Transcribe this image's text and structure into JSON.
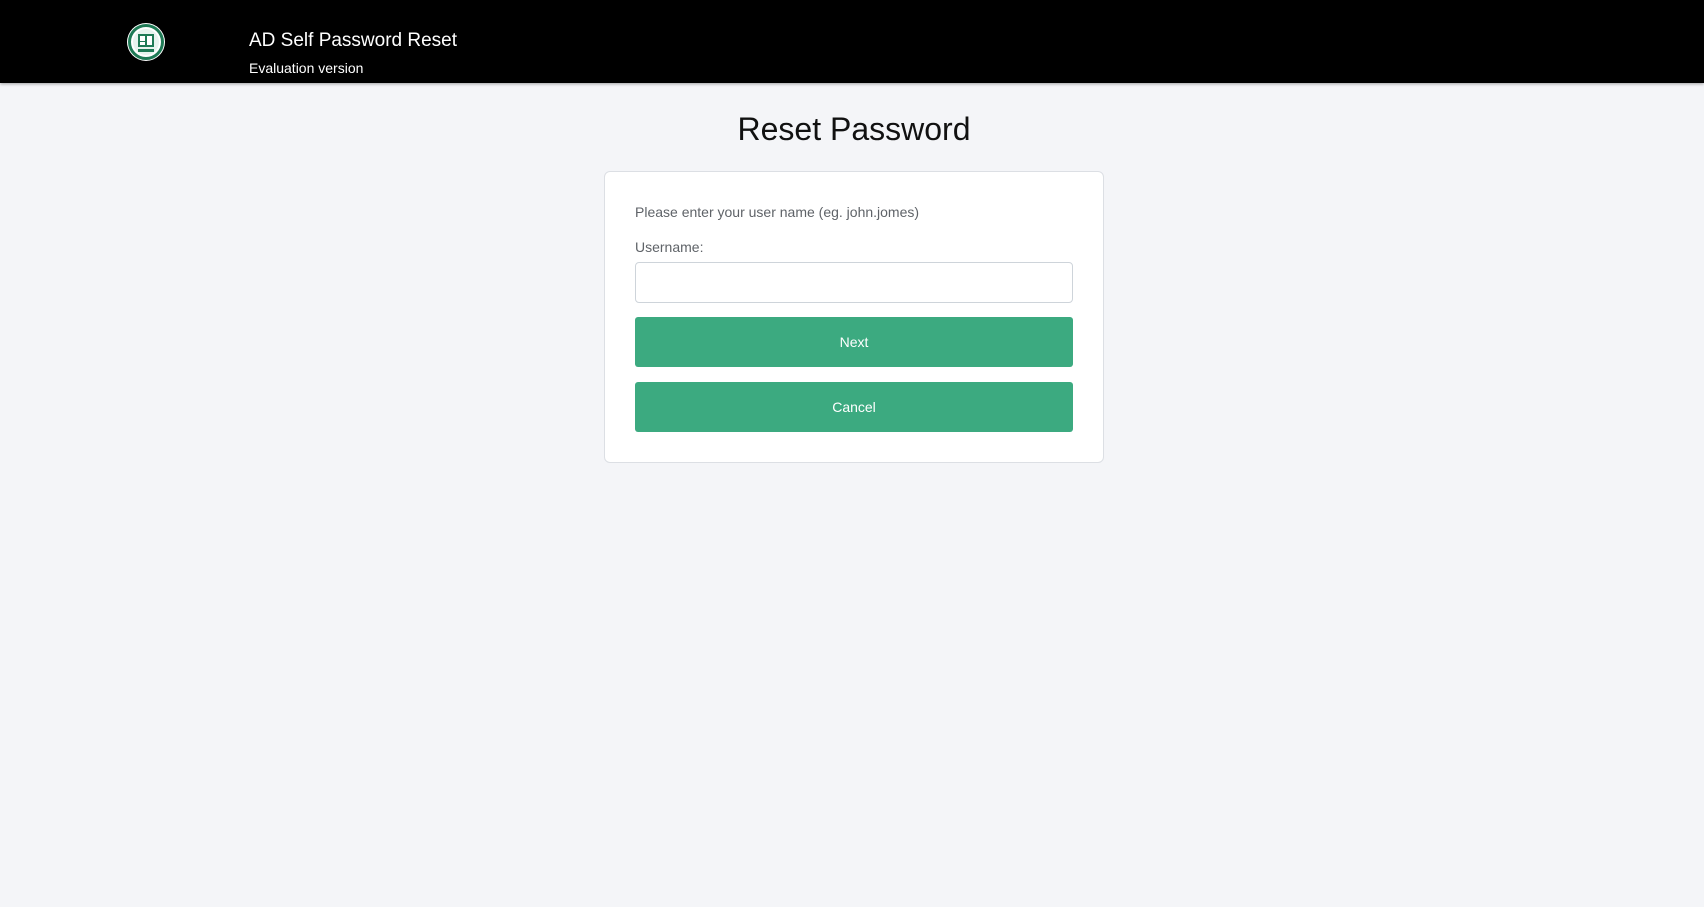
{
  "header": {
    "app_title": "AD Self Password Reset",
    "app_subtitle": "Evaluation version",
    "logo_icon": "organization-seal-logo",
    "background_color": "#000000"
  },
  "main": {
    "heading": "Reset Password",
    "form": {
      "hint": "Please enter your user name (eg. john.jomes)",
      "username_label": "Username:",
      "username_value": "",
      "username_placeholder": "",
      "next_label": "Next",
      "cancel_label": "Cancel"
    }
  },
  "colors": {
    "page_background": "#f4f5f8",
    "button": "#3caa80",
    "logo_accent": "#1f7a55"
  }
}
